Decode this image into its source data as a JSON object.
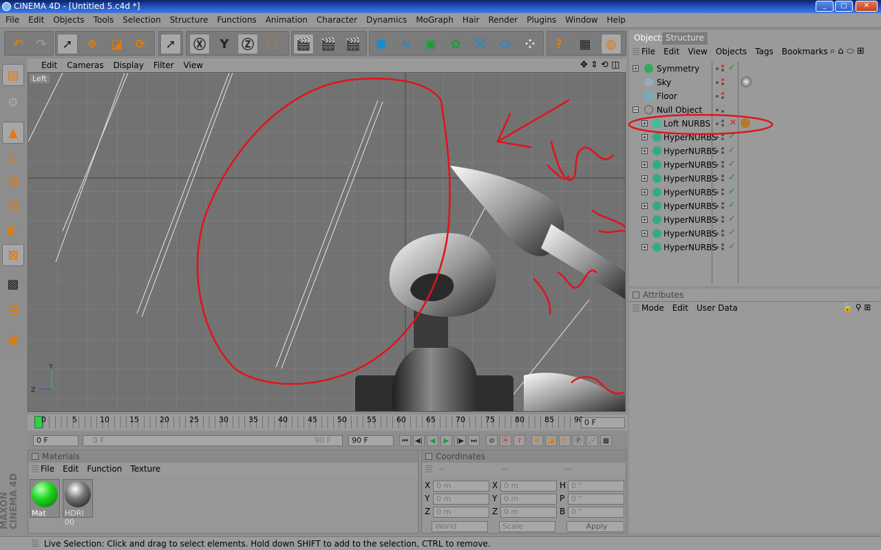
{
  "window": {
    "title": "CINEMA 4D - [Untitled 5.c4d *]"
  },
  "menu": [
    "File",
    "Edit",
    "Objects",
    "Tools",
    "Selection",
    "Structure",
    "Functions",
    "Animation",
    "Character",
    "Dynamics",
    "MoGraph",
    "Hair",
    "Render",
    "Plugins",
    "Window",
    "Help"
  ],
  "viewport": {
    "menu": [
      "Edit",
      "Cameras",
      "Display",
      "Filter",
      "View"
    ],
    "label": "Left"
  },
  "timeline": {
    "ticks": [
      "0",
      "5",
      "10",
      "15",
      "20",
      "25",
      "30",
      "35",
      "40",
      "45",
      "50",
      "55",
      "60",
      "65",
      "70",
      "75",
      "80",
      "85",
      "90"
    ],
    "current": "0 F"
  },
  "timectrl": {
    "start": "0 F",
    "range_left": "0 F",
    "range_right": "90 F",
    "end": "90 F"
  },
  "materials": {
    "title": "Materials",
    "menu": [
      "File",
      "Edit",
      "Function",
      "Texture"
    ],
    "items": [
      {
        "name": "Mat"
      },
      {
        "name": "HDRI 00"
      }
    ]
  },
  "coordinates": {
    "title": "Coordinates",
    "rows": [
      {
        "a": "X",
        "av": "0 m",
        "b": "X",
        "bv": "0 m",
        "c": "H",
        "cv": "0 °"
      },
      {
        "a": "Y",
        "av": "0 m",
        "b": "Y",
        "bv": "0 m",
        "c": "P",
        "cv": "0 °"
      },
      {
        "a": "Z",
        "av": "0 m",
        "b": "Z",
        "bv": "0 m",
        "c": "B",
        "cv": "0 °"
      }
    ],
    "mode": "World",
    "scale": "Scale",
    "apply": "Apply"
  },
  "objects": {
    "tabs": [
      "Objects",
      "Structure"
    ],
    "menu": [
      "File",
      "Edit",
      "View",
      "Objects",
      "Tags",
      "Bookmarks"
    ],
    "items": [
      {
        "name": "Symmetry"
      },
      {
        "name": "Sky"
      },
      {
        "name": "Floor"
      },
      {
        "name": "Null Object"
      },
      {
        "name": "Loft NURBS"
      },
      {
        "name": "HyperNURBS"
      },
      {
        "name": "HyperNURBS"
      },
      {
        "name": "HyperNURBS"
      },
      {
        "name": "HyperNURBS"
      },
      {
        "name": "HyperNURBS"
      },
      {
        "name": "HyperNURBS"
      },
      {
        "name": "HyperNURBS"
      },
      {
        "name": "HyperNURBS"
      },
      {
        "name": "HyperNURBS"
      }
    ]
  },
  "attributes": {
    "title": "Attributes",
    "menu": [
      "Mode",
      "Edit",
      "User Data"
    ]
  },
  "status": "Live Selection: Click and drag to select elements. Hold down SHIFT to add to the selection, CTRL to remove.",
  "logo": {
    "line1": "MAXON",
    "line2": "CINEMA 4D"
  },
  "colors": {
    "annotation_red": "#e0141c",
    "timeline_green": "#2fd14a"
  }
}
